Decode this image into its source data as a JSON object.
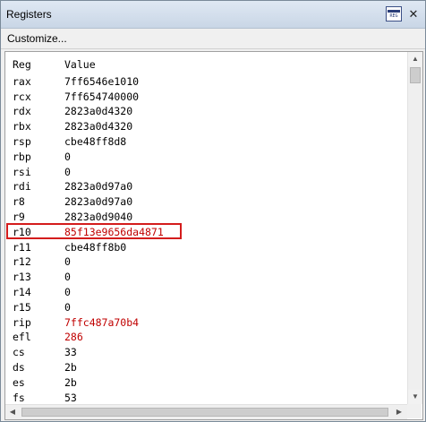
{
  "window": {
    "title": "Registers",
    "close_glyph": "✕",
    "icon_text": "REG"
  },
  "toolbar": {
    "customize_label": "Customize..."
  },
  "columns": {
    "reg": "Reg",
    "value": "Value"
  },
  "registers": [
    {
      "name": "rax",
      "value": "7ff6546e1010",
      "changed": false
    },
    {
      "name": "rcx",
      "value": "7ff654740000",
      "changed": false
    },
    {
      "name": "rdx",
      "value": "2823a0d4320",
      "changed": false
    },
    {
      "name": "rbx",
      "value": "2823a0d4320",
      "changed": false
    },
    {
      "name": "rsp",
      "value": "cbe48ff8d8",
      "changed": false
    },
    {
      "name": "rbp",
      "value": "0",
      "changed": false
    },
    {
      "name": "rsi",
      "value": "0",
      "changed": false
    },
    {
      "name": "rdi",
      "value": "2823a0d97a0",
      "changed": false
    },
    {
      "name": "r8",
      "value": "2823a0d97a0",
      "changed": false
    },
    {
      "name": "r9",
      "value": "2823a0d9040",
      "changed": false
    },
    {
      "name": "r10",
      "value": "85f13e9656da4871",
      "changed": true,
      "highlighted": true
    },
    {
      "name": "r11",
      "value": "cbe48ff8b0",
      "changed": false
    },
    {
      "name": "r12",
      "value": "0",
      "changed": false
    },
    {
      "name": "r13",
      "value": "0",
      "changed": false
    },
    {
      "name": "r14",
      "value": "0",
      "changed": false
    },
    {
      "name": "r15",
      "value": "0",
      "changed": false
    },
    {
      "name": "rip",
      "value": "7ffc487a70b4",
      "changed": true
    },
    {
      "name": "efl",
      "value": "286",
      "changed": true
    },
    {
      "name": "cs",
      "value": "33",
      "changed": false
    },
    {
      "name": "ds",
      "value": "2b",
      "changed": false
    },
    {
      "name": "es",
      "value": "2b",
      "changed": false
    },
    {
      "name": "fs",
      "value": "53",
      "changed": false
    }
  ],
  "colors": {
    "changed_value": "#c00000",
    "highlight_border": "#d41c1c"
  }
}
